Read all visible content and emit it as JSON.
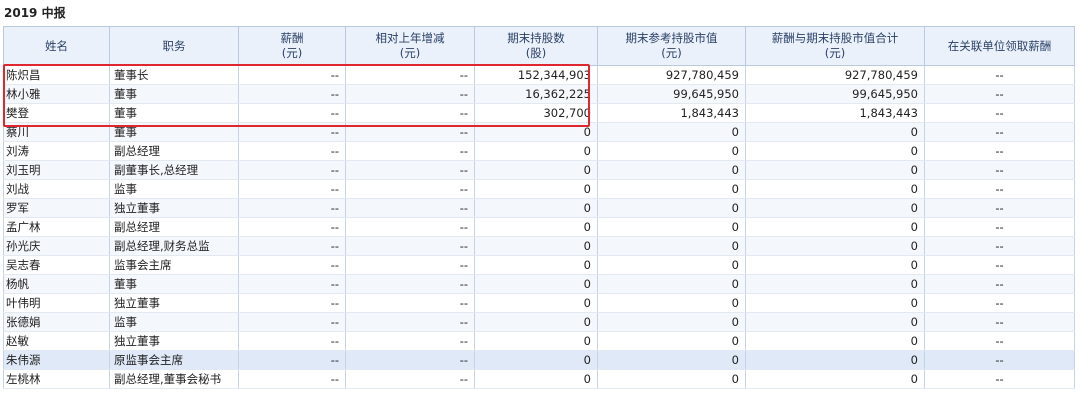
{
  "report_title": "2019 中报",
  "columns": [
    {
      "line1": "姓名",
      "line2": ""
    },
    {
      "line1": "职务",
      "line2": ""
    },
    {
      "line1": "薪酬",
      "line2": "(元)"
    },
    {
      "line1": "相对上年增减",
      "line2": "(元)"
    },
    {
      "line1": "期末持股数",
      "line2": "(股)"
    },
    {
      "line1": "期末参考持股市值",
      "line2": "(元)"
    },
    {
      "line1": "薪酬与期末持股市值合计",
      "line2": "(元)"
    },
    {
      "line1": "在关联单位领取薪酬",
      "line2": ""
    }
  ],
  "rows": [
    [
      "陈炽昌",
      "董事长",
      "--",
      "--",
      "152,344,903",
      "927,780,459",
      "927,780,459",
      "--"
    ],
    [
      "林小雅",
      "董事",
      "--",
      "--",
      "16,362,225",
      "99,645,950",
      "99,645,950",
      "--"
    ],
    [
      "樊登",
      "董事",
      "--",
      "--",
      "302,700",
      "1,843,443",
      "1,843,443",
      "--"
    ],
    [
      "蔡川",
      "董事",
      "--",
      "--",
      "0",
      "0",
      "0",
      "--"
    ],
    [
      "刘涛",
      "副总经理",
      "--",
      "--",
      "0",
      "0",
      "0",
      "--"
    ],
    [
      "刘玉明",
      "副董事长,总经理",
      "--",
      "--",
      "0",
      "0",
      "0",
      "--"
    ],
    [
      "刘战",
      "监事",
      "--",
      "--",
      "0",
      "0",
      "0",
      "--"
    ],
    [
      "罗军",
      "独立董事",
      "--",
      "--",
      "0",
      "0",
      "0",
      "--"
    ],
    [
      "孟广林",
      "副总经理",
      "--",
      "--",
      "0",
      "0",
      "0",
      "--"
    ],
    [
      "孙光庆",
      "副总经理,财务总监",
      "--",
      "--",
      "0",
      "0",
      "0",
      "--"
    ],
    [
      "吴志春",
      "监事会主席",
      "--",
      "--",
      "0",
      "0",
      "0",
      "--"
    ],
    [
      "杨帆",
      "董事",
      "--",
      "--",
      "0",
      "0",
      "0",
      "--"
    ],
    [
      "叶伟明",
      "独立董事",
      "--",
      "--",
      "0",
      "0",
      "0",
      "--"
    ],
    [
      "张德娟",
      "监事",
      "--",
      "--",
      "0",
      "0",
      "0",
      "--"
    ],
    [
      "赵敏",
      "独立董事",
      "--",
      "--",
      "0",
      "0",
      "0",
      "--"
    ],
    [
      "朱伟源",
      "原监事会主席",
      "--",
      "--",
      "0",
      "0",
      "0",
      "--"
    ],
    [
      "左桃林",
      "副总经理,董事会秘书",
      "--",
      "--",
      "0",
      "0",
      "0",
      "--"
    ]
  ],
  "highlighted_row_index": 15,
  "colors": {
    "highlight_box": "#e0262e",
    "header_bg": "#eaf1fb",
    "selected_row": "#dfe9f7"
  }
}
